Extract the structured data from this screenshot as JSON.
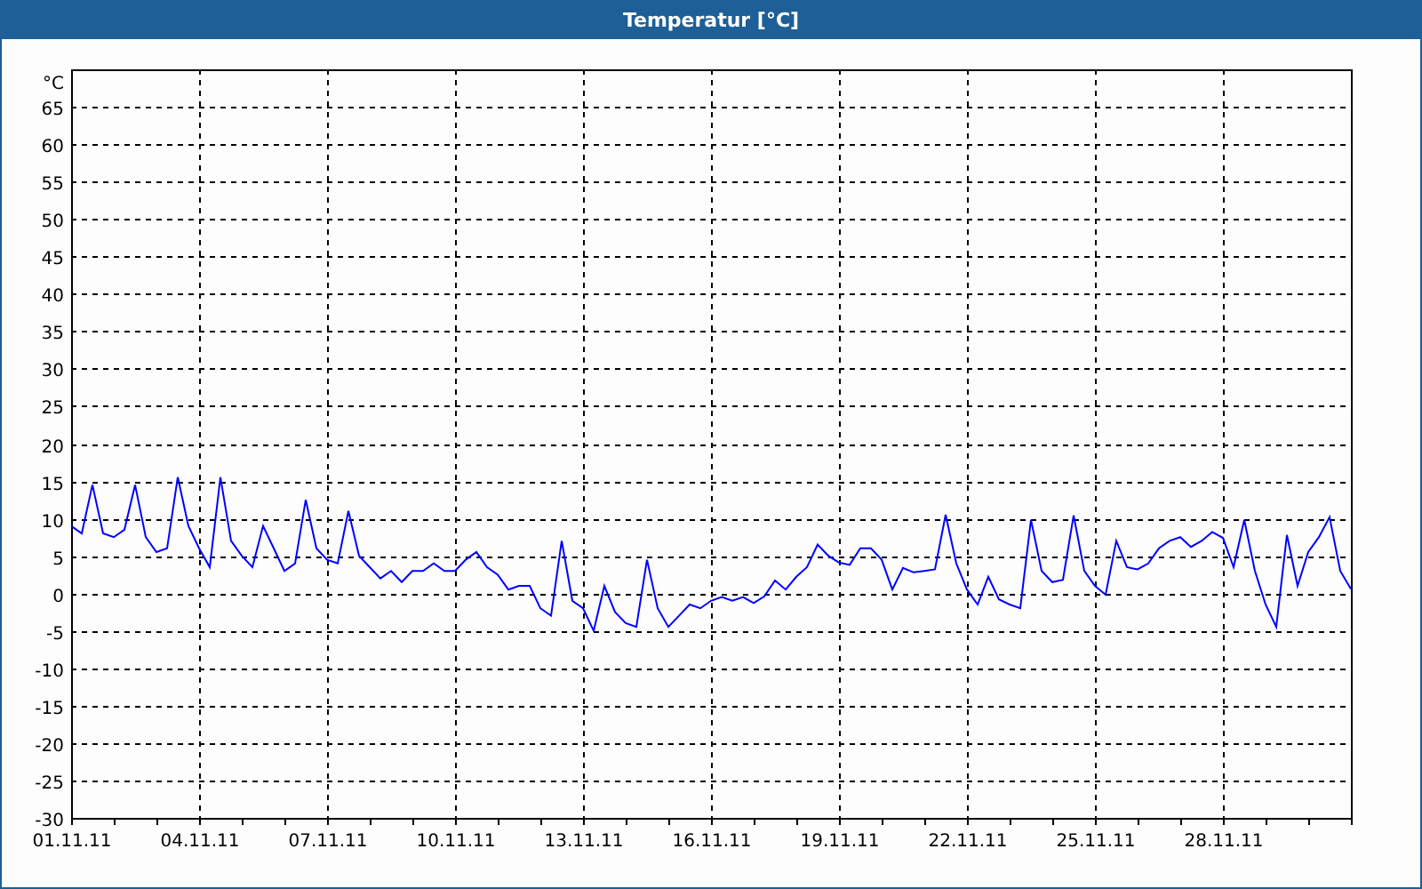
{
  "window": {
    "title": "Temperatur [°C]"
  },
  "chart": {
    "chart_data": {
      "type": "line",
      "grid": true,
      "ylabel": "°C",
      "ylim": [
        -30,
        70
      ],
      "yticks": [
        -30,
        -25,
        -20,
        -15,
        -10,
        -5,
        0,
        5,
        10,
        15,
        20,
        25,
        30,
        35,
        40,
        45,
        50,
        55,
        60,
        65
      ],
      "categories": [
        "01.11.11",
        null,
        null,
        null,
        null,
        null,
        null,
        null,
        null,
        null,
        null,
        null,
        "04.11.11",
        null,
        null,
        null,
        null,
        null,
        null,
        null,
        null,
        null,
        null,
        null,
        "07.11.11",
        null,
        null,
        null,
        null,
        null,
        null,
        null,
        null,
        null,
        null,
        null,
        "10.11.11",
        null,
        null,
        null,
        null,
        null,
        null,
        null,
        null,
        null,
        null,
        null,
        "13.11.11",
        null,
        null,
        null,
        null,
        null,
        null,
        null,
        null,
        null,
        null,
        null,
        "16.11.11",
        null,
        null,
        null,
        null,
        null,
        null,
        null,
        null,
        null,
        null,
        null,
        "19.11.11",
        null,
        null,
        null,
        null,
        null,
        null,
        null,
        null,
        null,
        null,
        null,
        "22.11.11",
        null,
        null,
        null,
        null,
        null,
        null,
        null,
        null,
        null,
        null,
        null,
        "25.11.11",
        null,
        null,
        null,
        null,
        null,
        null,
        null,
        null,
        null,
        null,
        null,
        "28.11.11",
        null,
        null,
        null,
        null,
        null,
        null,
        null,
        null,
        null,
        null,
        null,
        null
      ],
      "series": [
        {
          "color": "#0000ff",
          "values": [
            9,
            8,
            14.5,
            8,
            7.5,
            8.5,
            14.5,
            7.5,
            5.5,
            6,
            15.5,
            9,
            6,
            3.5,
            15.5,
            7,
            5,
            3.5,
            9,
            6,
            3,
            4,
            12.5,
            6,
            4.5,
            4,
            11,
            5,
            3.5,
            2,
            3,
            1.5,
            3,
            3,
            4,
            3,
            3,
            4.5,
            5.5,
            3.5,
            2.5,
            0.5,
            1,
            1,
            -2,
            -3,
            7,
            -1,
            -2,
            -5,
            1,
            -2.5,
            -4,
            -4.5,
            4.5,
            -2,
            -4.5,
            -3,
            -1.5,
            -2,
            -1,
            -0.5,
            -1,
            -0.5,
            -1.3,
            -0.4,
            1.7,
            0.5,
            2.2,
            3.5,
            6.5,
            5,
            4.1,
            3.8,
            6,
            6,
            4.5,
            0.5,
            3.4,
            2.8,
            3,
            3.2,
            10.5,
            4,
            0.5,
            -1.5,
            2.2,
            -0.8,
            -1.5,
            -2,
            9.8,
            3,
            1.5,
            1.8,
            10.4,
            3,
            1,
            -0.2,
            7,
            3.5,
            3.2,
            4,
            6,
            7,
            7.5,
            6.2,
            7,
            8.2,
            7.4,
            3.5,
            9.8,
            3,
            -1.5,
            -4.5,
            7.8,
            1,
            5.5,
            7.5,
            10.2,
            3,
            0.6
          ]
        }
      ]
    }
  }
}
